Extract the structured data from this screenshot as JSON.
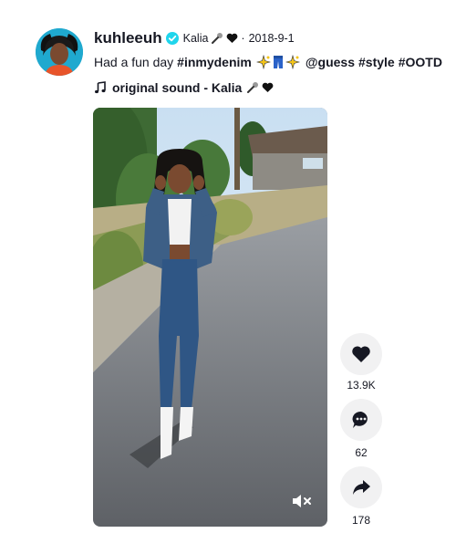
{
  "post": {
    "username": "kuhleeuh",
    "nickname": "Kalia",
    "separator": "·",
    "date": "2018-9-1",
    "caption": "Had a fun day",
    "hashtags": [
      "#inmydenim",
      "#style",
      "#OOTD"
    ],
    "mention": "@guess",
    "sound": "original sound - Kalia"
  },
  "actions": {
    "likes": "13.9K",
    "comments": "62",
    "shares": "178"
  },
  "colors": {
    "verified": "#20d5ec",
    "text": "#161823",
    "action_bg": "#f1f1f2"
  }
}
